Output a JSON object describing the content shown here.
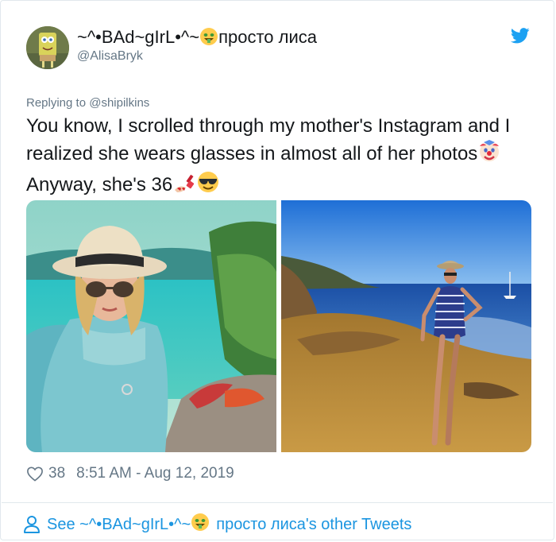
{
  "author": {
    "display_name_prefix": "~^•BAd~gIrL•^~",
    "display_name_suffix": "просто лиса",
    "handle": "@AlisaBryk",
    "avatar_icon": "spongebob-avatar",
    "name_emoji": "money-mouth-face-emoji"
  },
  "reply": {
    "prefix": "Replying to ",
    "target": "@shipilkins"
  },
  "tweet": {
    "text_part1": "You know, I scrolled through my mother's Instagram and I realized she wears glasses in almost all of her photos",
    "text_part2": "Anyway, she's 36",
    "emojis": [
      "clown-face-emoji",
      "nail-polish-emoji",
      "sunglasses-face-emoji"
    ]
  },
  "media": [
    {
      "name": "photo-woman-hat-sea-closeup"
    },
    {
      "name": "photo-woman-striped-dress-beach"
    }
  ],
  "meta": {
    "likes": "38",
    "timestamp": "8:51 AM - Aug 12, 2019"
  },
  "footer": {
    "see_prefix": "See ~^•BAd~gIrL•^~",
    "see_suffix": "просто лиса's other Tweets"
  },
  "colors": {
    "twitter_blue": "#1da1f2",
    "link_blue": "#1b95e0",
    "secondary_text": "#657786",
    "border": "#e1e8ed"
  }
}
